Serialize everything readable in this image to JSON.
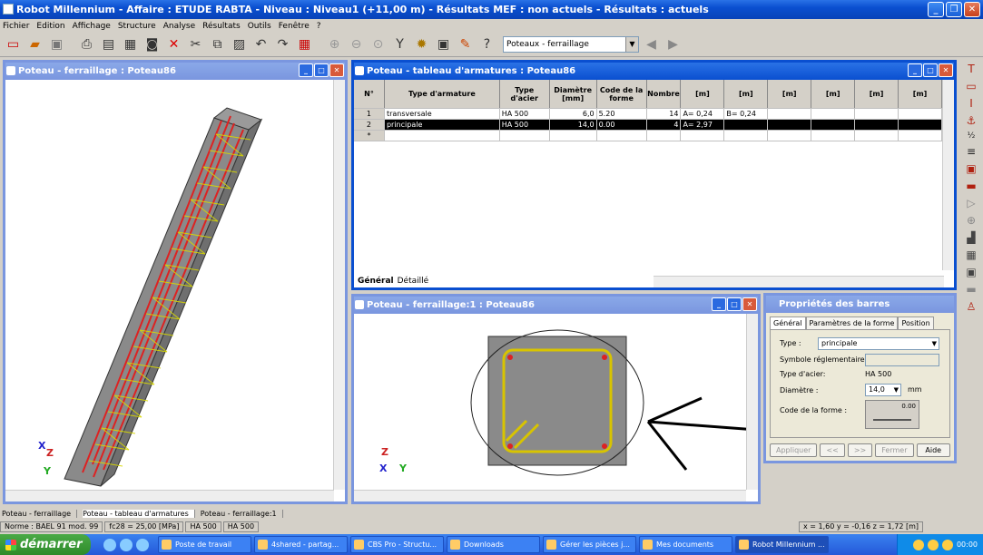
{
  "app": {
    "title": "Robot Millennium - Affaire : ETUDE RABTA - Niveau : Niveau1 (+11,00 m) - Résultats MEF : non actuels - Résultats : actuels"
  },
  "menu": [
    "Fichier",
    "Edition",
    "Affichage",
    "Structure",
    "Analyse",
    "Résultats",
    "Outils",
    "Fenêtre",
    "?"
  ],
  "toolbar": {
    "combo_value": "Poteaux - ferraillage"
  },
  "win_3d": {
    "title": "Poteau - ferraillage : Poteau86",
    "axis_x": "X",
    "axis_y": "Y",
    "axis_z": "Z"
  },
  "win_table": {
    "title": "Poteau - tableau d'armatures : Poteau86",
    "headers": [
      "N°",
      "Type d'armature",
      "Type d'acier",
      "Diamètre [mm]",
      "Code de la forme",
      "Nombre",
      "[m]",
      "[m]",
      "[m]",
      "[m]",
      "[m]",
      "[m]"
    ],
    "rows": [
      [
        "1",
        "transversale",
        "HA  500",
        "6,0",
        "5.20",
        "14",
        "A= 0,24",
        "B= 0,24",
        "",
        "",
        "",
        ""
      ],
      [
        "2",
        "principale",
        "HA  500",
        "14,0",
        "0.00",
        "4",
        "A= 2,97",
        "",
        "",
        "",
        "",
        ""
      ],
      [
        "*",
        "",
        "",
        "",
        "",
        "",
        "",
        "",
        "",
        "",
        "",
        ""
      ]
    ],
    "tab_general": "Général",
    "tab_detail": "Détaillé"
  },
  "win_section": {
    "title": "Poteau - ferraillage:1 : Poteau86",
    "axis_x": "X",
    "axis_y": "Y",
    "axis_z": "Z"
  },
  "props": {
    "title": "Propriétés des barres",
    "tabs": [
      "Général",
      "Paramètres de la forme",
      "Position"
    ],
    "type_label": "Type :",
    "type_value": "principale",
    "symbole_label": "Symbole réglementaire :",
    "acier_label": "Type d'acier:",
    "acier_value": "HA  500",
    "diam_label": "Diamètre :",
    "diam_value": "14,0",
    "diam_unit": "mm",
    "code_label": "Code de la forme :",
    "code_value": "0.00",
    "btn_apply": "Appliquer",
    "btn_prev": "<<",
    "btn_next": ">>",
    "btn_close": "Fermer",
    "btn_help": "Aide"
  },
  "mdi_tabs": [
    "Poteau - ferraillage",
    "Poteau - tableau d'armatures",
    "Poteau - ferraillage:1"
  ],
  "status": {
    "norme": "Norme : BAEL 91 mod. 99",
    "fc28": "fc28 = 25,00 [MPa]",
    "ha1": "HA  500",
    "ha2": "HA  500",
    "coords": "x = 1,60  y = -0,16  z = 1,72  [m]"
  },
  "taskbar": {
    "start": "démarrer",
    "items": [
      "Poste de travail",
      "4shared - partag...",
      "CBS Pro - Structu...",
      "Downloads",
      "Gérer les pièces j...",
      "Mes documents",
      "Robot Millennium ..."
    ],
    "clock": "00:00"
  }
}
